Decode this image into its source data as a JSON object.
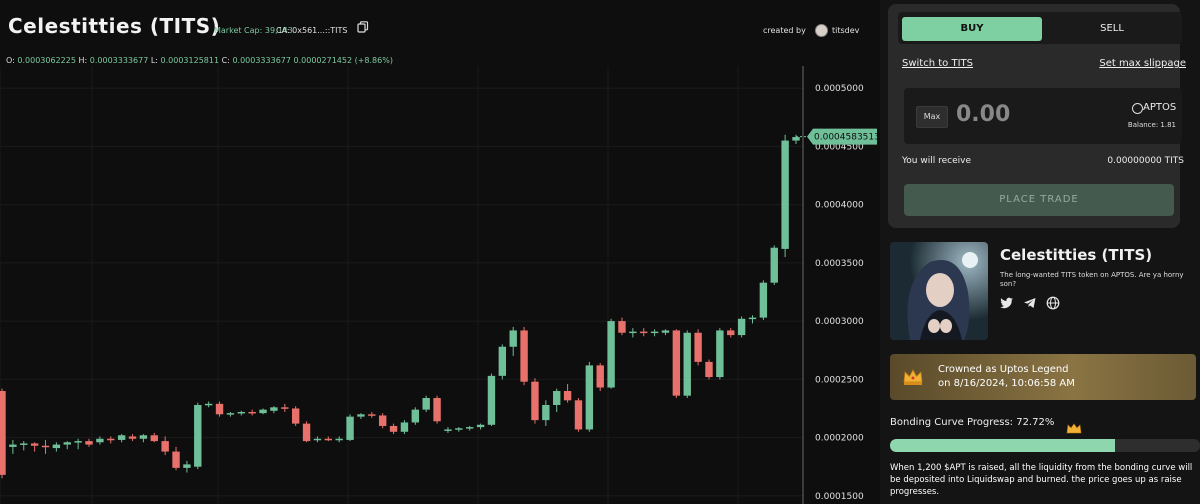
{
  "header": {
    "title": "Celestitties (TITS)",
    "market_cap": "Market Cap: 39,143",
    "ca": "CA: 0x561...::TITS",
    "created_by_label": "created by",
    "creator": "titsdev"
  },
  "ohlc": {
    "o_label": "O:",
    "o": "0.0003062225",
    "h_label": "H:",
    "h": "0.0003333677",
    "l_label": "L:",
    "l": "0.0003125811",
    "c_label": "C:",
    "c": "0.0003333677",
    "change": "0.0000271452 (+8.86%)"
  },
  "chart_data": {
    "type": "candlestick",
    "y_ticks": [
      "0.0005000",
      "0.0004500",
      "0.0004000",
      "0.0003500",
      "0.0003000",
      "0.0002500",
      "0.0002000",
      "0.0001500"
    ],
    "ylim": [
      0.000143,
      0.000519
    ],
    "last_price_label": "0.0004583513",
    "last_price": 0.0004583513,
    "up_color": "#6fbf98",
    "down_color": "#e8716b",
    "candles": [
      [
        0.00024,
        0.000242,
        0.000165,
        0.000168
      ],
      [
        0.000192,
        0.000198,
        0.000186,
        0.000194
      ],
      [
        0.000194,
        0.000197,
        0.000189,
        0.000195
      ],
      [
        0.000195,
        0.000196,
        0.000188,
        0.000193
      ],
      [
        0.000193,
        0.000198,
        0.000186,
        0.000192
      ],
      [
        0.000191,
        0.000196,
        0.000188,
        0.000194
      ],
      [
        0.000194,
        0.000197,
        0.00019,
        0.000196
      ],
      [
        0.000196,
        0.000199,
        0.00019,
        0.000197
      ],
      [
        0.000197,
        0.000199,
        0.000192,
        0.000194
      ],
      [
        0.000196,
        0.000201,
        0.000194,
        0.000199
      ],
      [
        0.000199,
        0.000201,
        0.000195,
        0.000198
      ],
      [
        0.000198,
        0.000203,
        0.000196,
        0.000202
      ],
      [
        0.000201,
        0.000203,
        0.000197,
        0.000199
      ],
      [
        0.000199,
        0.000203,
        0.000196,
        0.000202
      ],
      [
        0.000202,
        0.000204,
        0.000196,
        0.000197
      ],
      [
        0.000197,
        0.000201,
        0.000185,
        0.000188
      ],
      [
        0.000188,
        0.000192,
        0.000172,
        0.000174
      ],
      [
        0.000174,
        0.00018,
        0.00017,
        0.000177
      ],
      [
        0.000175,
        0.00023,
        0.000173,
        0.000228
      ],
      [
        0.000228,
        0.000231,
        0.000226,
        0.000229
      ],
      [
        0.000229,
        0.000231,
        0.000218,
        0.00022
      ],
      [
        0.00022,
        0.000222,
        0.000218,
        0.000221
      ],
      [
        0.000221,
        0.000223,
        0.000219,
        0.000222
      ],
      [
        0.000222,
        0.000224,
        0.000219,
        0.000221
      ],
      [
        0.000221,
        0.000225,
        0.00022,
        0.000224
      ],
      [
        0.000223,
        0.000227,
        0.000221,
        0.000226
      ],
      [
        0.000226,
        0.000229,
        0.000222,
        0.000225
      ],
      [
        0.000225,
        0.000227,
        0.00021,
        0.000212
      ],
      [
        0.000212,
        0.000214,
        0.000196,
        0.000197
      ],
      [
        0.000198,
        0.000201,
        0.000196,
        0.000199
      ],
      [
        0.000199,
        0.000201,
        0.000197,
        0.000198
      ],
      [
        0.000198,
        0.000201,
        0.000196,
        0.000199
      ],
      [
        0.000198,
        0.00022,
        0.000197,
        0.000218
      ],
      [
        0.000218,
        0.000221,
        0.000216,
        0.00022
      ],
      [
        0.00022,
        0.000222,
        0.000217,
        0.000219
      ],
      [
        0.000219,
        0.000221,
        0.000208,
        0.00021
      ],
      [
        0.00021,
        0.000212,
        0.000203,
        0.000205
      ],
      [
        0.000205,
        0.000215,
        0.000203,
        0.000213
      ],
      [
        0.000213,
        0.000226,
        0.000211,
        0.000224
      ],
      [
        0.000224,
        0.000236,
        0.000222,
        0.000234
      ],
      [
        0.000234,
        0.000236,
        0.000212,
        0.000214
      ],
      [
        0.000206,
        0.000209,
        0.000204,
        0.000207
      ],
      [
        0.000207,
        0.000209,
        0.000205,
        0.000208
      ],
      [
        0.000208,
        0.00021,
        0.000206,
        0.000209
      ],
      [
        0.000209,
        0.000212,
        0.000207,
        0.000211
      ],
      [
        0.000211,
        0.000255,
        0.00021,
        0.000253
      ],
      [
        0.000253,
        0.00028,
        0.00025,
        0.000278
      ],
      [
        0.000278,
        0.000295,
        0.00027,
        0.000292
      ],
      [
        0.000292,
        0.000295,
        0.000245,
        0.000248
      ],
      [
        0.000248,
        0.000251,
        0.000212,
        0.000215
      ],
      [
        0.000215,
        0.000232,
        0.00021,
        0.000228
      ],
      [
        0.000228,
        0.000242,
        0.000222,
        0.00024
      ],
      [
        0.00024,
        0.000246,
        0.00023,
        0.000232
      ],
      [
        0.000232,
        0.000234,
        0.000205,
        0.000207
      ],
      [
        0.000207,
        0.000265,
        0.000205,
        0.000262
      ],
      [
        0.000262,
        0.000264,
        0.00024,
        0.000243
      ],
      [
        0.000243,
        0.000302,
        0.000242,
        0.0003
      ],
      [
        0.0003,
        0.000303,
        0.000288,
        0.00029
      ],
      [
        0.00029,
        0.000294,
        0.000286,
        0.000291
      ],
      [
        0.000291,
        0.000294,
        0.000287,
        0.00029
      ],
      [
        0.00029,
        0.000293,
        0.000287,
        0.000291
      ],
      [
        0.00029,
        0.000293,
        0.000288,
        0.000292
      ],
      [
        0.000292,
        0.000293,
        0.000234,
        0.000236
      ],
      [
        0.000236,
        0.000292,
        0.000234,
        0.00029
      ],
      [
        0.00029,
        0.000293,
        0.000262,
        0.000265
      ],
      [
        0.000265,
        0.000267,
        0.00025,
        0.000252
      ],
      [
        0.000252,
        0.000294,
        0.00025,
        0.000292
      ],
      [
        0.000292,
        0.000294,
        0.000286,
        0.000288
      ],
      [
        0.000288,
        0.000304,
        0.000286,
        0.000302
      ],
      [
        0.000302,
        0.000305,
        0.000298,
        0.000303
      ],
      [
        0.000303,
        0.000335,
        0.000301,
        0.000333
      ],
      [
        0.000333,
        0.000365,
        0.000331,
        0.000363
      ],
      [
        0.000362,
        0.00046,
        0.000355,
        0.000455
      ],
      [
        0.000455,
        0.00046,
        0.000452,
        0.000458
      ]
    ]
  },
  "trade": {
    "buy": "BUY",
    "sell": "SELL",
    "switch": "Switch to TITS",
    "slippage": "Set max slippage",
    "max": "Max",
    "amount": "0.00",
    "currency": "APTOS",
    "balance": "Balance: 1.81",
    "receive_label": "You will receive",
    "receive_value": "0.00000000 TITS",
    "place": "PLACE TRADE"
  },
  "token": {
    "name": "Celestitties (TITS)",
    "description": "The long-wanted TITS token on APTOS. Are ya horny son?"
  },
  "crown": {
    "line1": "Crowned as Uptos Legend",
    "line2": "on 8/16/2024, 10:06:58 AM"
  },
  "bonding": {
    "label": "Bonding Curve Progress: 72.72%",
    "progress": 0.7272,
    "description": "When 1,200 $APT is raised, all the liquidity from the bonding curve will be deposited into Liquidswap and burned. the price goes up as raise progresses."
  },
  "colors": {
    "accent": "#7ecfa1",
    "up": "#6fbf98",
    "down": "#e8716b"
  }
}
